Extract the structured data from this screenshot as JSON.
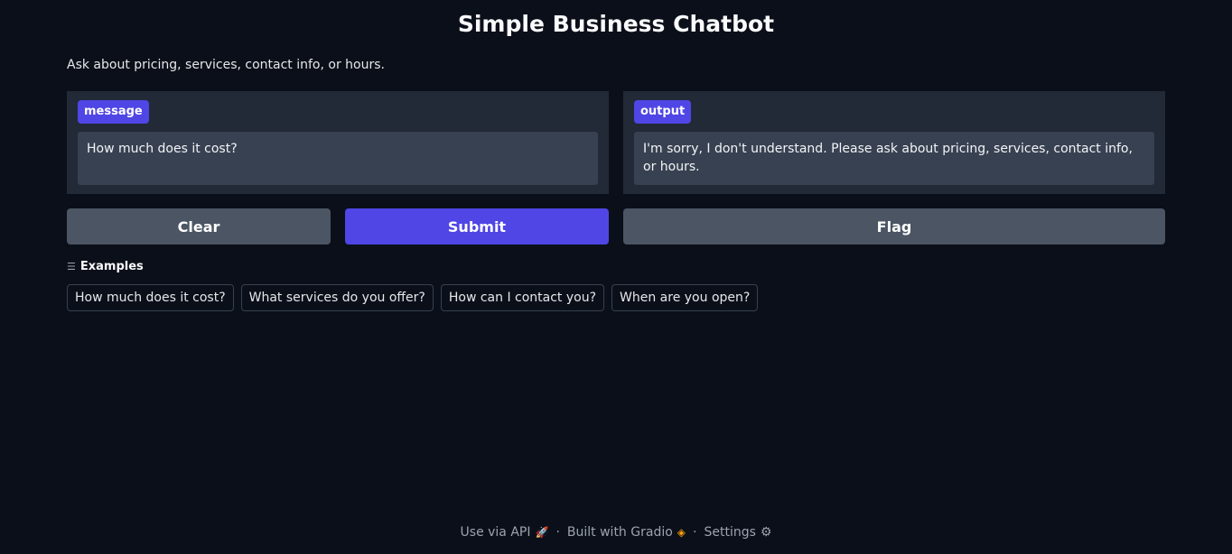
{
  "header": {
    "title": "Simple Business Chatbot"
  },
  "description": "Ask about pricing, services, contact info, or hours.",
  "input_panel": {
    "label": "message",
    "value": "How much does it cost?"
  },
  "output_panel": {
    "label": "output",
    "value": "I'm sorry, I don't understand. Please ask about pricing, services, contact info, or hours."
  },
  "buttons": {
    "clear": "Clear",
    "submit": "Submit",
    "flag": "Flag"
  },
  "examples": {
    "heading": "Examples",
    "items": [
      "How much does it cost?",
      "What services do you offer?",
      "How can I contact you?",
      "When are you open?"
    ]
  },
  "footer": {
    "api": "Use via API",
    "built": "Built with Gradio",
    "settings": "Settings",
    "separator": "·"
  },
  "colors": {
    "background": "#0b0f19",
    "panel": "#222937",
    "accent": "#4f46e5",
    "secondary_button": "#4b5563"
  },
  "icons": [
    "list-icon",
    "rocket-icon",
    "gradio-logo-icon",
    "gear-icon"
  ]
}
